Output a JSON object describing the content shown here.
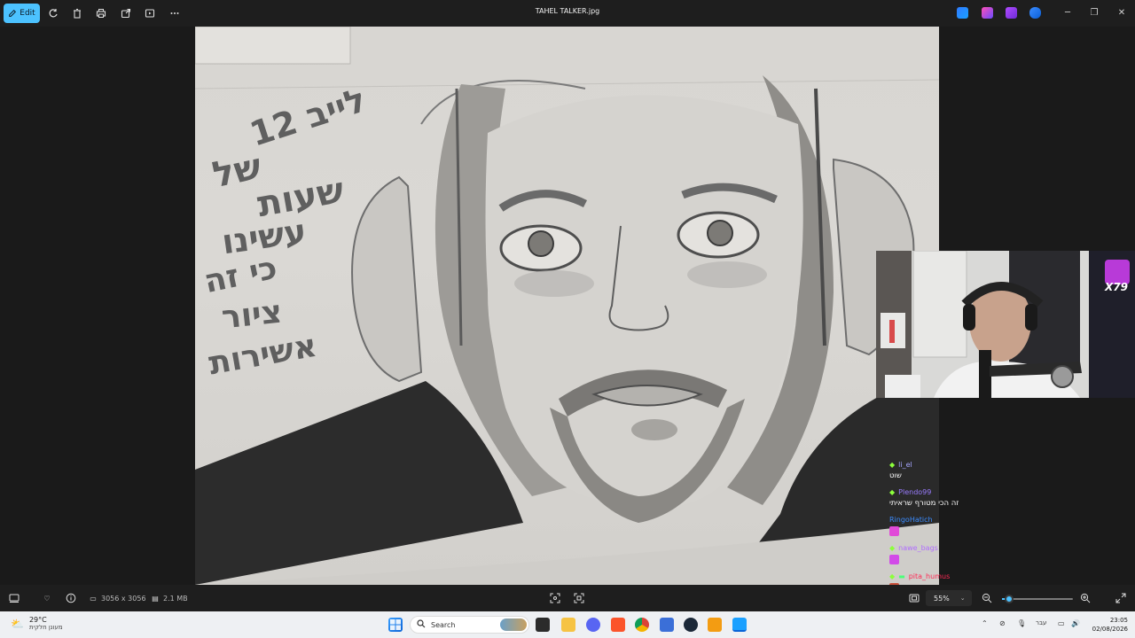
{
  "titlebar": {
    "edit_label": "Edit",
    "title": "TAHEL TALKER.jpg",
    "icons": [
      "rotate-icon",
      "delete-icon",
      "print-icon",
      "share-icon",
      "slideshow-icon",
      "more-icon"
    ]
  },
  "drawing": {
    "hebrew_lines": [
      "לייב 12",
      "של",
      "שעות",
      "עשינו",
      "כי זה",
      "ציור",
      "אשירות"
    ]
  },
  "webcam": {
    "badge": "X79"
  },
  "chat": {
    "messages": [
      {
        "user": "li_el",
        "user_color": "#a6a6ff",
        "text": "שוט"
      },
      {
        "user": "Plendo99",
        "user_color": "#9a7cff",
        "text": "זה הכי מטורף שראיתי"
      },
      {
        "user": "RingoHatich",
        "user_color": "#3b8cff",
        "text": ""
      },
      {
        "user": "nawe_bags",
        "user_color": "#b06cff",
        "text": ""
      },
      {
        "user": "pita_humus",
        "user_color": "#ff2a55",
        "text": ""
      }
    ]
  },
  "bottombar": {
    "dimensions": "3056 x 3056",
    "file_size": "2.1 MB",
    "zoom": "55%",
    "zoom_level": 0.1
  },
  "taskbar": {
    "temperature": "29°C",
    "weather_desc": "מעונן חלקית",
    "search_placeholder": "Search",
    "language": "עבר",
    "time": "23:05",
    "date": "02/08/2026"
  },
  "colors": {
    "accent": "#4cc2ff",
    "window_bg": "#1e1e1e",
    "taskbar_bg": "#eef0f3"
  }
}
